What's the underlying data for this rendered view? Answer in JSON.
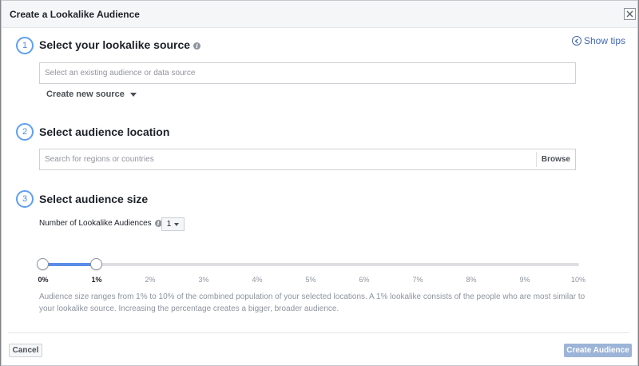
{
  "dialog": {
    "title": "Create a Lookalike Audience",
    "show_tips": "Show tips"
  },
  "steps": [
    {
      "number": "1",
      "title": "Select your lookalike source"
    },
    {
      "number": "2",
      "title": "Select audience location"
    },
    {
      "number": "3",
      "title": "Select audience size"
    }
  ],
  "source": {
    "placeholder": "Select an existing audience or data source",
    "value": "",
    "create_new_label": "Create new source"
  },
  "location": {
    "placeholder": "Search for regions or countries",
    "value": "",
    "browse_label": "Browse"
  },
  "size": {
    "count_label": "Number of Lookalike Audiences",
    "count_value": "1",
    "slider_range_percent": [
      0,
      1
    ],
    "ticks": [
      "0%",
      "1%",
      "2%",
      "3%",
      "4%",
      "5%",
      "6%",
      "7%",
      "8%",
      "9%",
      "10%"
    ],
    "helper_text": "Audience size ranges from 1% to 10% of the combined population of your selected locations. A 1% lookalike consists of the people who are most similar to your lookalike source. Increasing the percentage creates a bigger, broader audience."
  },
  "footer": {
    "cancel_label": "Cancel",
    "create_label": "Create Audience"
  },
  "colors": {
    "accent": "#4267b2",
    "step_circle": "#5f9ff2",
    "slider_fill": "#5b8de8",
    "disabled_primary": "#9cb4d8"
  }
}
